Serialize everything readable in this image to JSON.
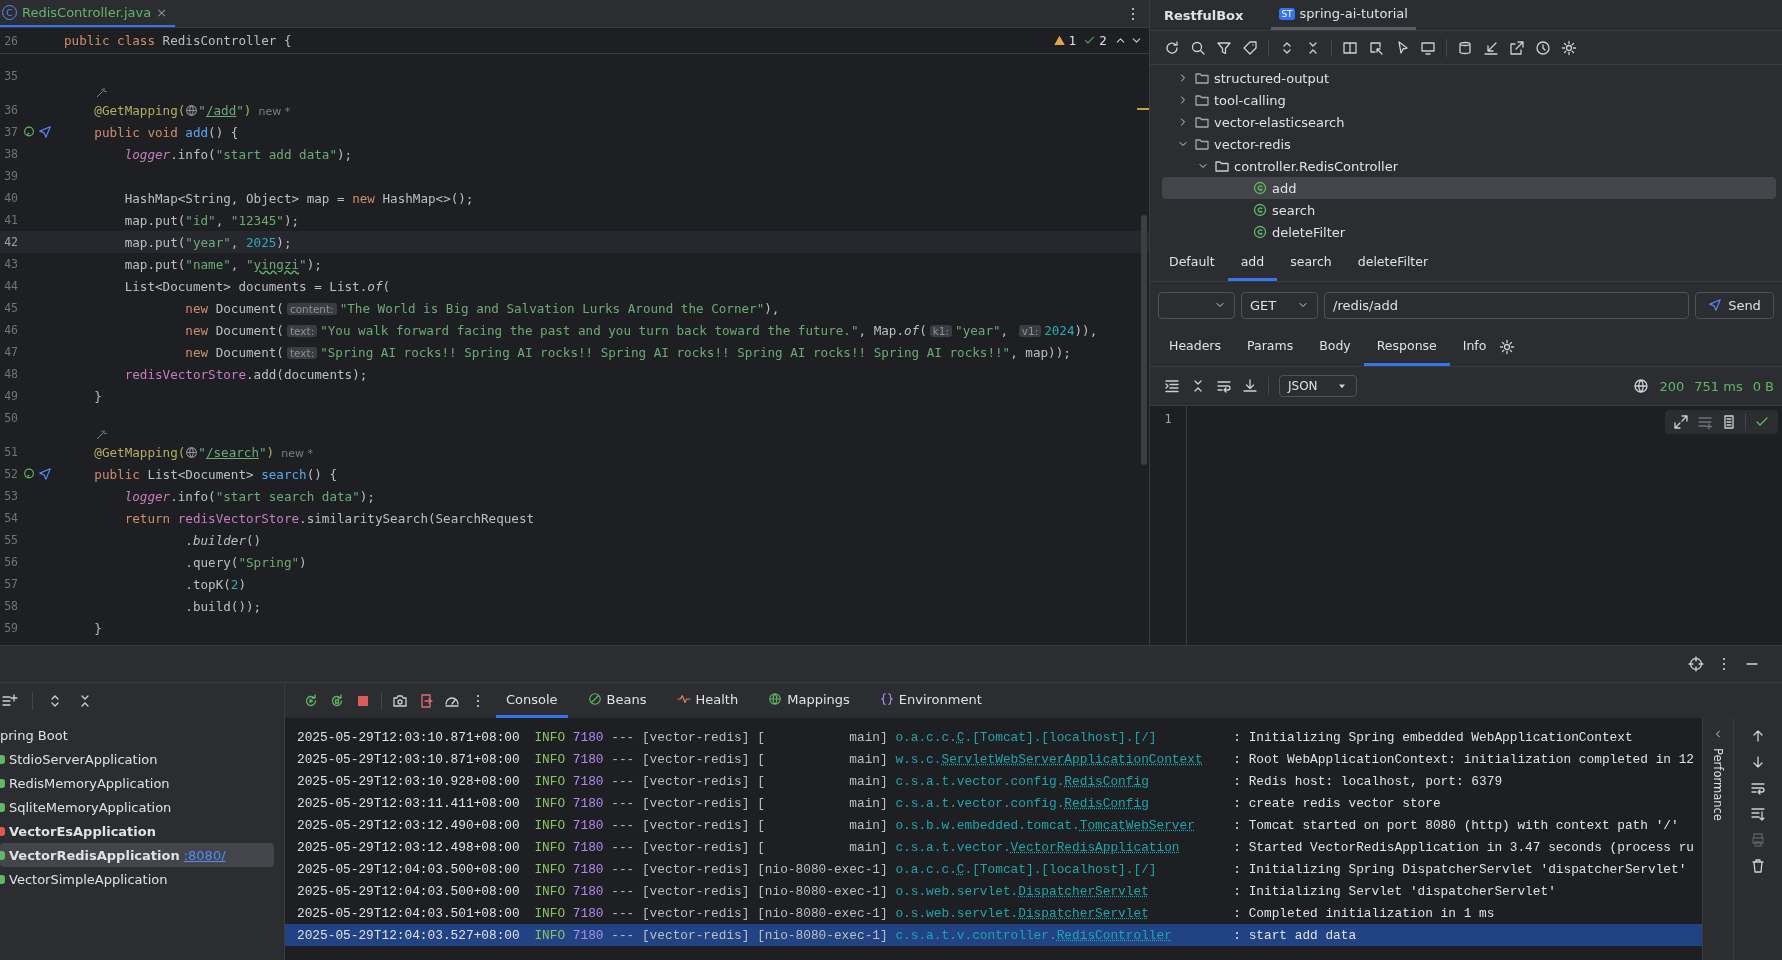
{
  "editor": {
    "tab": {
      "badge": "C",
      "label": "RedisController.java",
      "close": "×"
    },
    "inspections": {
      "warnings": "1",
      "checks": "2"
    },
    "sticky_line": {
      "number": "26",
      "tokens": [
        {
          "kind": "kw",
          "text": "public class "
        },
        {
          "kind": "plain",
          "text": "RedisController {"
        }
      ]
    },
    "lines": [
      {
        "kind": "code",
        "number": "35"
      },
      {
        "kind": "inlay"
      },
      {
        "kind": "code",
        "number": "36",
        "tokens": [
          {
            "kind": "annot",
            "text": "    @GetMapping("
          },
          {
            "kind": "globe"
          },
          {
            "kind": "str",
            "text": "\""
          },
          {
            "kind": "url",
            "text": "/add"
          },
          {
            "kind": "str",
            "text": "\""
          },
          {
            "kind": "annot",
            "text": ")"
          },
          {
            "kind": "muted",
            "text": "  new *"
          }
        ]
      },
      {
        "kind": "code",
        "number": "37",
        "endpoint_marker": true,
        "tokens": [
          {
            "kind": "kw",
            "text": "    public void "
          },
          {
            "kind": "decl",
            "text": "add"
          },
          {
            "kind": "plain",
            "text": "() {"
          }
        ]
      },
      {
        "kind": "code",
        "number": "38",
        "tokens": [
          {
            "kind": "field_italic",
            "text": "        logger"
          },
          {
            "kind": "plain",
            "text": ".info("
          },
          {
            "kind": "str",
            "text": "\"start add data\""
          },
          {
            "kind": "plain",
            "text": ");"
          }
        ]
      },
      {
        "kind": "code",
        "number": "39"
      },
      {
        "kind": "code",
        "number": "40",
        "tokens": [
          {
            "kind": "plain",
            "text": "        HashMap<String, Object> map = "
          },
          {
            "kind": "kw",
            "text": "new "
          },
          {
            "kind": "plain",
            "text": "HashMap<>();"
          }
        ]
      },
      {
        "kind": "code",
        "number": "41",
        "tokens": [
          {
            "kind": "plain",
            "text": "        map.put("
          },
          {
            "kind": "str",
            "text": "\"id\""
          },
          {
            "kind": "plain",
            "text": ", "
          },
          {
            "kind": "str",
            "text": "\"12345\""
          },
          {
            "kind": "plain",
            "text": ");"
          }
        ]
      },
      {
        "kind": "code",
        "number": "42",
        "current": true,
        "tokens": [
          {
            "kind": "plain",
            "text": "        map.put("
          },
          {
            "kind": "str",
            "text": "\"year\""
          },
          {
            "kind": "plain",
            "text": ", "
          },
          {
            "kind": "num",
            "text": "2025"
          },
          {
            "kind": "plain",
            "text": ");"
          }
        ]
      },
      {
        "kind": "code",
        "number": "43",
        "tokens": [
          {
            "kind": "plain",
            "text": "        map.put("
          },
          {
            "kind": "str",
            "text": "\"name\""
          },
          {
            "kind": "plain",
            "text": ", "
          },
          {
            "kind": "str",
            "text": "\""
          },
          {
            "kind": "typo",
            "text": "yingzi"
          },
          {
            "kind": "str",
            "text": "\""
          },
          {
            "kind": "plain",
            "text": ");"
          }
        ]
      },
      {
        "kind": "code",
        "number": "44",
        "tokens": [
          {
            "kind": "plain",
            "text": "        List<Document> documents = List."
          },
          {
            "kind": "italic",
            "text": "of"
          },
          {
            "kind": "plain",
            "text": "("
          }
        ]
      },
      {
        "kind": "code",
        "number": "45",
        "tokens": [
          {
            "kind": "kw",
            "text": "                new "
          },
          {
            "kind": "plain",
            "text": "Document("
          },
          {
            "kind": "hint",
            "text": "content:"
          },
          {
            "kind": "str",
            "text": "\"The World is Big and Salvation Lurks Around the Corner\""
          },
          {
            "kind": "plain",
            "text": "),"
          }
        ]
      },
      {
        "kind": "code",
        "number": "46",
        "tokens": [
          {
            "kind": "kw",
            "text": "                new "
          },
          {
            "kind": "plain",
            "text": "Document("
          },
          {
            "kind": "hint",
            "text": "text:"
          },
          {
            "kind": "str",
            "text": "\"You walk forward facing the past and you turn back toward the future.\""
          },
          {
            "kind": "plain",
            "text": ", Map."
          },
          {
            "kind": "italic",
            "text": "of"
          },
          {
            "kind": "plain",
            "text": "("
          },
          {
            "kind": "hint",
            "text": "k1:"
          },
          {
            "kind": "str",
            "text": "\"year\""
          },
          {
            "kind": "plain",
            "text": ", "
          },
          {
            "kind": "hint",
            "text": "v1:"
          },
          {
            "kind": "num",
            "text": "2024"
          },
          {
            "kind": "plain",
            "text": ")),"
          }
        ]
      },
      {
        "kind": "code",
        "number": "47",
        "tokens": [
          {
            "kind": "kw",
            "text": "                new "
          },
          {
            "kind": "plain",
            "text": "Document("
          },
          {
            "kind": "hint",
            "text": "text:"
          },
          {
            "kind": "str",
            "text": "\"Spring AI rocks!! Spring AI rocks!! Spring AI rocks!! Spring AI rocks!! Spring AI rocks!!\""
          },
          {
            "kind": "plain",
            "text": ", map));"
          }
        ]
      },
      {
        "kind": "code",
        "number": "48",
        "tokens": [
          {
            "kind": "field",
            "text": "        redisVectorStore"
          },
          {
            "kind": "plain",
            "text": ".add(documents);"
          }
        ]
      },
      {
        "kind": "code",
        "number": "49",
        "tokens": [
          {
            "kind": "plain",
            "text": "    }"
          }
        ]
      },
      {
        "kind": "code",
        "number": "50"
      },
      {
        "kind": "inlay"
      },
      {
        "kind": "code",
        "number": "51",
        "tokens": [
          {
            "kind": "annot",
            "text": "    @GetMapping("
          },
          {
            "kind": "globe"
          },
          {
            "kind": "str",
            "text": "\""
          },
          {
            "kind": "url",
            "text": "/search"
          },
          {
            "kind": "str",
            "text": "\""
          },
          {
            "kind": "annot",
            "text": ")"
          },
          {
            "kind": "muted",
            "text": "  new *"
          }
        ]
      },
      {
        "kind": "code",
        "number": "52",
        "endpoint_marker": true,
        "tokens": [
          {
            "kind": "kw",
            "text": "    public "
          },
          {
            "kind": "plain",
            "text": "List<Document> "
          },
          {
            "kind": "decl",
            "text": "search"
          },
          {
            "kind": "plain",
            "text": "() {"
          }
        ]
      },
      {
        "kind": "code",
        "number": "53",
        "tokens": [
          {
            "kind": "field_italic",
            "text": "        logger"
          },
          {
            "kind": "plain",
            "text": ".info("
          },
          {
            "kind": "str",
            "text": "\"start search data\""
          },
          {
            "kind": "plain",
            "text": ");"
          }
        ]
      },
      {
        "kind": "code",
        "number": "54",
        "tokens": [
          {
            "kind": "kw",
            "text": "        return "
          },
          {
            "kind": "field",
            "text": "redisVectorStore"
          },
          {
            "kind": "plain",
            "text": ".similaritySearch(SearchRequest"
          }
        ]
      },
      {
        "kind": "code",
        "number": "55",
        "tokens": [
          {
            "kind": "plain",
            "text": "                ."
          },
          {
            "kind": "italic",
            "text": "builder"
          },
          {
            "kind": "plain",
            "text": "()"
          }
        ]
      },
      {
        "kind": "code",
        "number": "56",
        "tokens": [
          {
            "kind": "plain",
            "text": "                .query("
          },
          {
            "kind": "str",
            "text": "\"Spring\""
          },
          {
            "kind": "plain",
            "text": ")"
          }
        ]
      },
      {
        "kind": "code",
        "number": "57",
        "tokens": [
          {
            "kind": "plain",
            "text": "                .topK("
          },
          {
            "kind": "num",
            "text": "2"
          },
          {
            "kind": "plain",
            "text": ")"
          }
        ]
      },
      {
        "kind": "code",
        "number": "58",
        "tokens": [
          {
            "kind": "plain",
            "text": "                .build());"
          }
        ]
      },
      {
        "kind": "code",
        "number": "59",
        "tokens": [
          {
            "kind": "plain",
            "text": "    }"
          }
        ]
      }
    ]
  },
  "restful_box": {
    "title": "RestfulBox",
    "project_tab": {
      "badge": "ST",
      "label": "spring-ai-tutorial",
      "selected": true
    },
    "tree": [
      {
        "kind": "module",
        "label": "structured-output",
        "expanded": false,
        "selected": false
      },
      {
        "kind": "module",
        "label": "tool-calling",
        "expanded": false,
        "selected": false
      },
      {
        "kind": "module",
        "label": "vector-elasticsearch",
        "expanded": false,
        "selected": false
      },
      {
        "kind": "module",
        "label": "vector-redis",
        "expanded": true,
        "selected": false,
        "children": [
          {
            "kind": "package",
            "label": "controller.RedisController",
            "expanded": true,
            "selected": false,
            "children": [
              {
                "kind": "endpoint",
                "label": "add",
                "selected": true
              },
              {
                "kind": "endpoint",
                "label": "search",
                "selected": false
              },
              {
                "kind": "endpoint",
                "label": "deleteFilter",
                "selected": false
              }
            ]
          }
        ]
      }
    ],
    "request_tabs": [
      {
        "label": "Default",
        "selected": false
      },
      {
        "label": "add",
        "selected": true
      },
      {
        "label": "search",
        "selected": false
      },
      {
        "label": "deleteFilter",
        "selected": false
      }
    ],
    "request": {
      "method": "GET",
      "url": "/redis/add",
      "send": "Send"
    },
    "detail_tabs": [
      {
        "label": "Headers",
        "selected": false
      },
      {
        "label": "Params",
        "selected": false
      },
      {
        "label": "Body",
        "selected": false
      },
      {
        "label": "Response",
        "selected": true
      },
      {
        "label": "Info",
        "selected": false
      }
    ],
    "response": {
      "format": "JSON",
      "status": "200",
      "time": "751 ms",
      "size": "0 B",
      "line_number": "1"
    }
  },
  "services": {
    "tree": [
      {
        "label": "pring Boot",
        "kind": "group",
        "running": false,
        "selected": false
      },
      {
        "label": "StdioServerApplication",
        "kind": "app",
        "running": false,
        "selected": false,
        "color": "#5fb865"
      },
      {
        "label": "RedisMemoryApplication",
        "kind": "app",
        "running": false,
        "selected": false,
        "color": "#5fb865"
      },
      {
        "label": "SqliteMemoryApplication",
        "kind": "app",
        "running": false,
        "selected": false,
        "color": "#5fb865"
      },
      {
        "label": "VectorEsApplication",
        "kind": "app",
        "running": true,
        "selected": false,
        "color": "#e05555"
      },
      {
        "label": "VectorRedisApplication",
        "kind": "app",
        "running": true,
        "selected": true,
        "color": "#5fb865",
        "link": ":8080/"
      },
      {
        "label": "VectorSimpleApplication",
        "kind": "app",
        "running": false,
        "selected": false,
        "color": "#5fb865"
      }
    ]
  },
  "console": {
    "tabs": [
      {
        "kind": "console",
        "label": "Console",
        "selected": true
      },
      {
        "kind": "beans",
        "label": "Beans",
        "selected": false
      },
      {
        "kind": "health",
        "label": "Health",
        "selected": false
      },
      {
        "kind": "mappings",
        "label": "Mappings",
        "selected": false
      },
      {
        "kind": "environment",
        "label": "Environment",
        "selected": false
      }
    ],
    "side_label": "Performance",
    "lines": [
      {
        "timestamp": "2025-05-29T12:03:10.871+08:00",
        "level": "INFO",
        "pid": "7180",
        "separator": "---",
        "app": "[vector-redis]",
        "thread": "[           main]",
        "logger": [
          {
            "text": "o.a.c.c.",
            "link": false
          },
          {
            "text": "C",
            "link": true
          },
          {
            "text": ".[Tomcat].[localhost].[/]",
            "link": false
          }
        ],
        "message": ": Initializing Spring embedded WebApplicationContext",
        "selected": false
      },
      {
        "timestamp": "2025-05-29T12:03:10.871+08:00",
        "level": "INFO",
        "pid": "7180",
        "separator": "---",
        "app": "[vector-redis]",
        "thread": "[           main]",
        "logger": [
          {
            "text": "w.s.c.",
            "link": false
          },
          {
            "text": "ServletWebServerApplicationContext",
            "link": true
          }
        ],
        "message": ": Root WebApplicationContext: initialization completed in 12",
        "selected": false
      },
      {
        "timestamp": "2025-05-29T12:03:10.928+08:00",
        "level": "INFO",
        "pid": "7180",
        "separator": "---",
        "app": "[vector-redis]",
        "thread": "[           main]",
        "logger": [
          {
            "text": "c.s.a.t.vector.config.",
            "link": false
          },
          {
            "text": "RedisConfig",
            "link": true
          }
        ],
        "message": ": Redis host: localhost, port: 6379",
        "selected": false
      },
      {
        "timestamp": "2025-05-29T12:03:11.411+08:00",
        "level": "INFO",
        "pid": "7180",
        "separator": "---",
        "app": "[vector-redis]",
        "thread": "[           main]",
        "logger": [
          {
            "text": "c.s.a.t.vector.config.",
            "link": false
          },
          {
            "text": "RedisConfig",
            "link": true
          }
        ],
        "message": ": create redis vector store",
        "selected": false
      },
      {
        "timestamp": "2025-05-29T12:03:12.490+08:00",
        "level": "INFO",
        "pid": "7180",
        "separator": "---",
        "app": "[vector-redis]",
        "thread": "[           main]",
        "logger": [
          {
            "text": "o.s.b.w.embedded.tomcat.",
            "link": false
          },
          {
            "text": "TomcatWebServer",
            "link": true
          }
        ],
        "message": ": Tomcat started on port 8080 (http) with context path '/'",
        "selected": false
      },
      {
        "timestamp": "2025-05-29T12:03:12.498+08:00",
        "level": "INFO",
        "pid": "7180",
        "separator": "---",
        "app": "[vector-redis]",
        "thread": "[           main]",
        "logger": [
          {
            "text": "c.s.a.t.vector.",
            "link": false
          },
          {
            "text": "VectorRedisApplication",
            "link": true
          }
        ],
        "message": ": Started VectorRedisApplication in 3.47 seconds (process ru",
        "selected": false
      },
      {
        "timestamp": "2025-05-29T12:04:03.500+08:00",
        "level": "INFO",
        "pid": "7180",
        "separator": "---",
        "app": "[vector-redis]",
        "thread": "[nio-8080-exec-1]",
        "logger": [
          {
            "text": "o.a.c.c.",
            "link": false
          },
          {
            "text": "C",
            "link": true
          },
          {
            "text": ".[Tomcat].[localhost].[/]",
            "link": false
          }
        ],
        "message": ": Initializing Spring DispatcherServlet 'dispatcherServlet'",
        "selected": false
      },
      {
        "timestamp": "2025-05-29T12:04:03.500+08:00",
        "level": "INFO",
        "pid": "7180",
        "separator": "---",
        "app": "[vector-redis]",
        "thread": "[nio-8080-exec-1]",
        "logger": [
          {
            "text": "o.s.web.servlet.",
            "link": false
          },
          {
            "text": "DispatcherServlet",
            "link": true
          }
        ],
        "message": ": Initializing Servlet 'dispatcherServlet'",
        "selected": false
      },
      {
        "timestamp": "2025-05-29T12:04:03.501+08:00",
        "level": "INFO",
        "pid": "7180",
        "separator": "---",
        "app": "[vector-redis]",
        "thread": "[nio-8080-exec-1]",
        "logger": [
          {
            "text": "o.s.web.servlet.",
            "link": false
          },
          {
            "text": "DispatcherServlet",
            "link": true
          }
        ],
        "message": ": Completed initialization in 1 ms",
        "selected": false
      },
      {
        "timestamp": "2025-05-29T12:04:03.527+08:00",
        "level": "INFO",
        "pid": "7180",
        "separator": "---",
        "app": "[vector-redis]",
        "thread": "[nio-8080-exec-1]",
        "logger": [
          {
            "text": "c.s.a.t.v.controller.",
            "link": false
          },
          {
            "text": "RedisController",
            "link": true
          }
        ],
        "message": ": start add data",
        "selected": true
      }
    ]
  }
}
